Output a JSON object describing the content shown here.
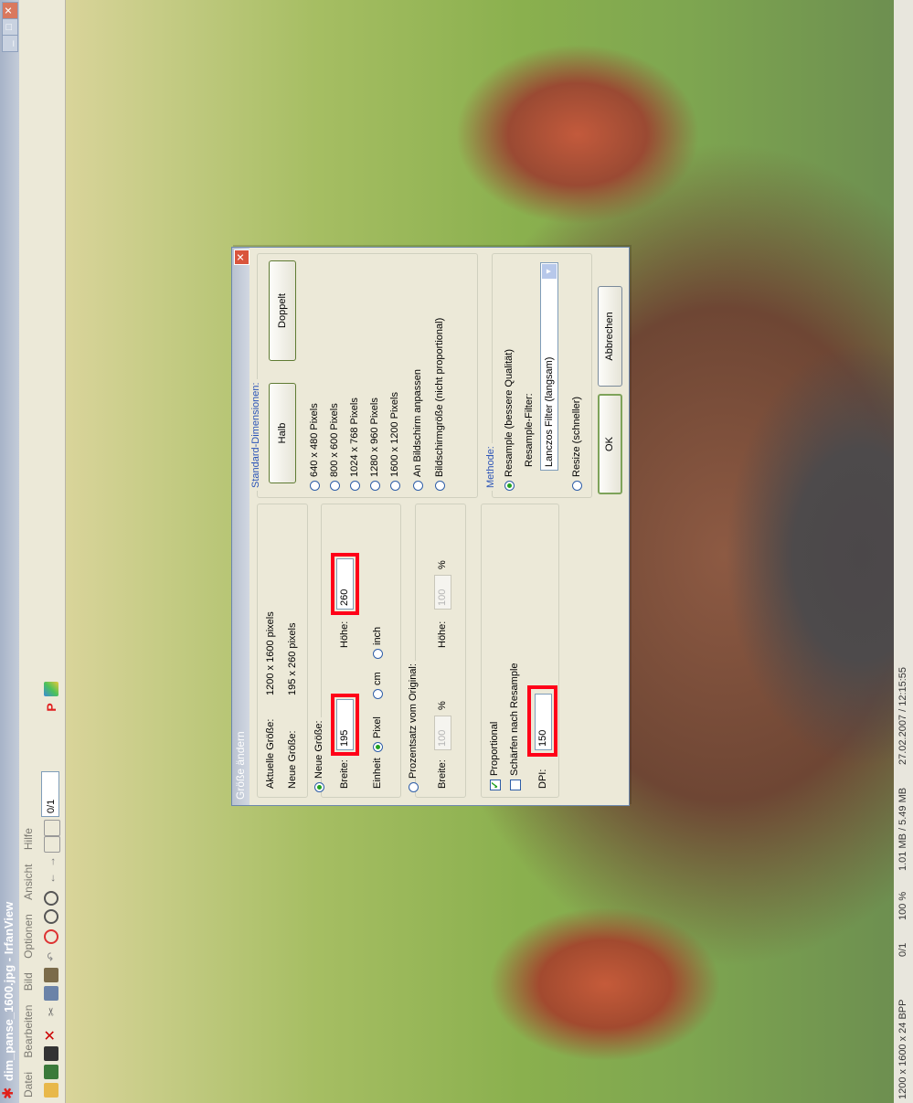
{
  "window": {
    "title": "dim_panse_1600.jpg - IrfanView",
    "minimize_glyph": "_",
    "maximize_glyph": "□",
    "close_glyph": "✕"
  },
  "menu": [
    "Datei",
    "Bearbeiten",
    "Bild",
    "Optionen",
    "Ansicht",
    "Hilfe"
  ],
  "toolbar": {
    "page_value": "0/1",
    "icons": [
      "open-icon",
      "save-icon",
      "slideshow-icon",
      "delete-icon",
      "cut-icon",
      "copy-icon",
      "paste-icon",
      "undo-icon",
      "info-icon",
      "zoom-in-icon",
      "zoom-out-icon",
      "previous-icon",
      "next-icon",
      "first-icon",
      "last-icon",
      "paint-icon",
      "palette-icon"
    ]
  },
  "status": {
    "dimensions": "1200 x 1600 x 24 BPP",
    "index": "0/1",
    "zoom": "100 %",
    "memory": "1.01 MB / 5.49 MB",
    "datetime": "27.02.2007 / 12:15:55"
  },
  "dialog": {
    "title": "Größe ändern",
    "current_size_label": "Aktuelle Größe:",
    "current_size_value": "1200 x 1600  pixels",
    "new_size_label": "Neue Größe:",
    "new_size_value": "195 x 260  pixels",
    "radio_new_size": "Neue Größe:",
    "width_label": "Breite:",
    "width_value": "195",
    "height_label": "Höhe:",
    "height_value": "260",
    "unit_label": "Einheit",
    "unit_pixel": "Pixel",
    "unit_cm": "cm",
    "unit_inch": "inch",
    "radio_percent": "Prozentsatz vom Original:",
    "pct_width_label": "Breite:",
    "pct_width_value": "100",
    "pct_sign": "%",
    "pct_height_label": "Höhe:",
    "pct_height_value": "100",
    "proportional_label": "Proportional",
    "sharpen_label": "Schärfen nach Resample",
    "dpi_label": "DPI:",
    "dpi_value": "150",
    "standard_title": "Standard-Dimensionen:",
    "half_button": "Halb",
    "double_button": "Doppelt",
    "presets": [
      "640 x 480 Pixels",
      "800 x 600 Pixels",
      "1024 x 768 Pixels",
      "1280 x 960 Pixels",
      "1600 x 1200 Pixels",
      "An Bildschirm anpassen",
      "Bildschirmgröße (nicht proportional)"
    ],
    "method_title": "Methode:",
    "resample_label": "Resample (bessere Qualität)",
    "resample_filter_label": "Resample-Filter:",
    "resample_filter_value": "Lanczos Filter (langsam)",
    "resize_label": "Resize (schneller)",
    "ok_button": "OK",
    "cancel_button": "Abbrechen"
  },
  "colors": {
    "highlight": "#ff0018",
    "radio_dot": "#21a121",
    "dialog_bg": "#ece9d8",
    "group_title": "#2b54b7"
  }
}
